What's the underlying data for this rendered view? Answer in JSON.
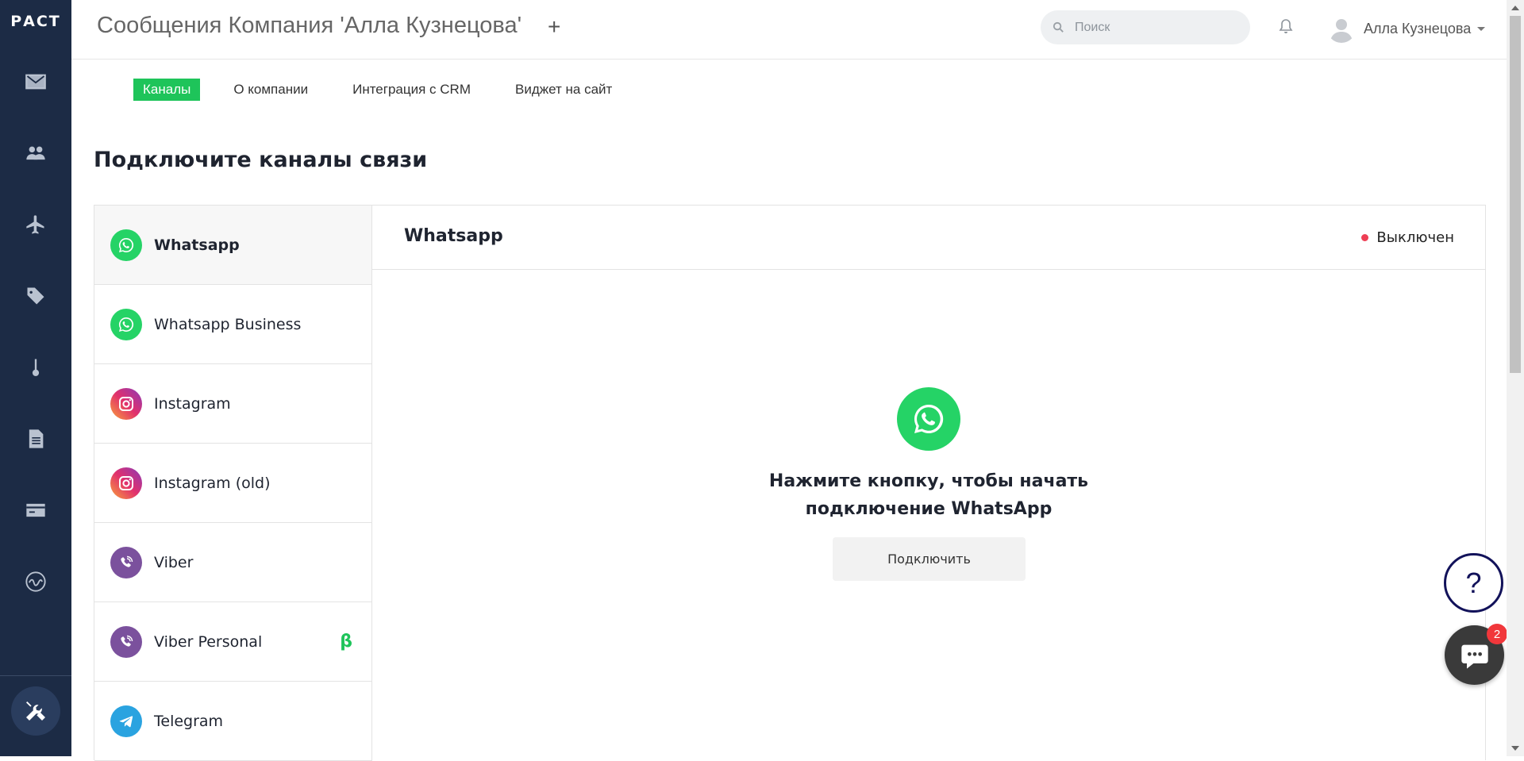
{
  "app": {
    "logo": "РАСТ",
    "title": "Сообщения Компания 'Алла Кузнецова'",
    "add_label": "+"
  },
  "search": {
    "placeholder": "Поиск"
  },
  "user": {
    "name": "Алла Кузнецова"
  },
  "tabs": [
    {
      "label": "Каналы",
      "active": true
    },
    {
      "label": "О компании"
    },
    {
      "label": "Интеграция с CRM"
    },
    {
      "label": "Виджет на сайт"
    }
  ],
  "section_title": "Подключите каналы связи",
  "channels": [
    {
      "label": "Whatsapp",
      "icon": "whatsapp-icon"
    },
    {
      "label": "Whatsapp Business",
      "icon": "whatsapp-icon"
    },
    {
      "label": "Instagram",
      "icon": "instagram-icon"
    },
    {
      "label": "Instagram (old)",
      "icon": "instagram-icon"
    },
    {
      "label": "Viber",
      "icon": "viber-icon"
    },
    {
      "label": "Viber Personal",
      "icon": "viber-icon",
      "badge": "β"
    },
    {
      "label": "Telegram",
      "icon": "telegram-icon"
    }
  ],
  "detail": {
    "title": "Whatsapp",
    "status": "Выключен",
    "cta_line1": "Нажмите кнопку, чтобы начать",
    "cta_line2": "подключение WhatsApp",
    "connect_label": "Подключить"
  },
  "help": {
    "label": "?"
  },
  "chat": {
    "badge_count": "2"
  },
  "colors": {
    "sidebar_bg": "#1c2b45",
    "accent_green": "#1ec45a",
    "whatsapp": "#25d366",
    "viber": "#7b519d",
    "telegram": "#2aa3e0",
    "status_off": "#ee3e54"
  }
}
